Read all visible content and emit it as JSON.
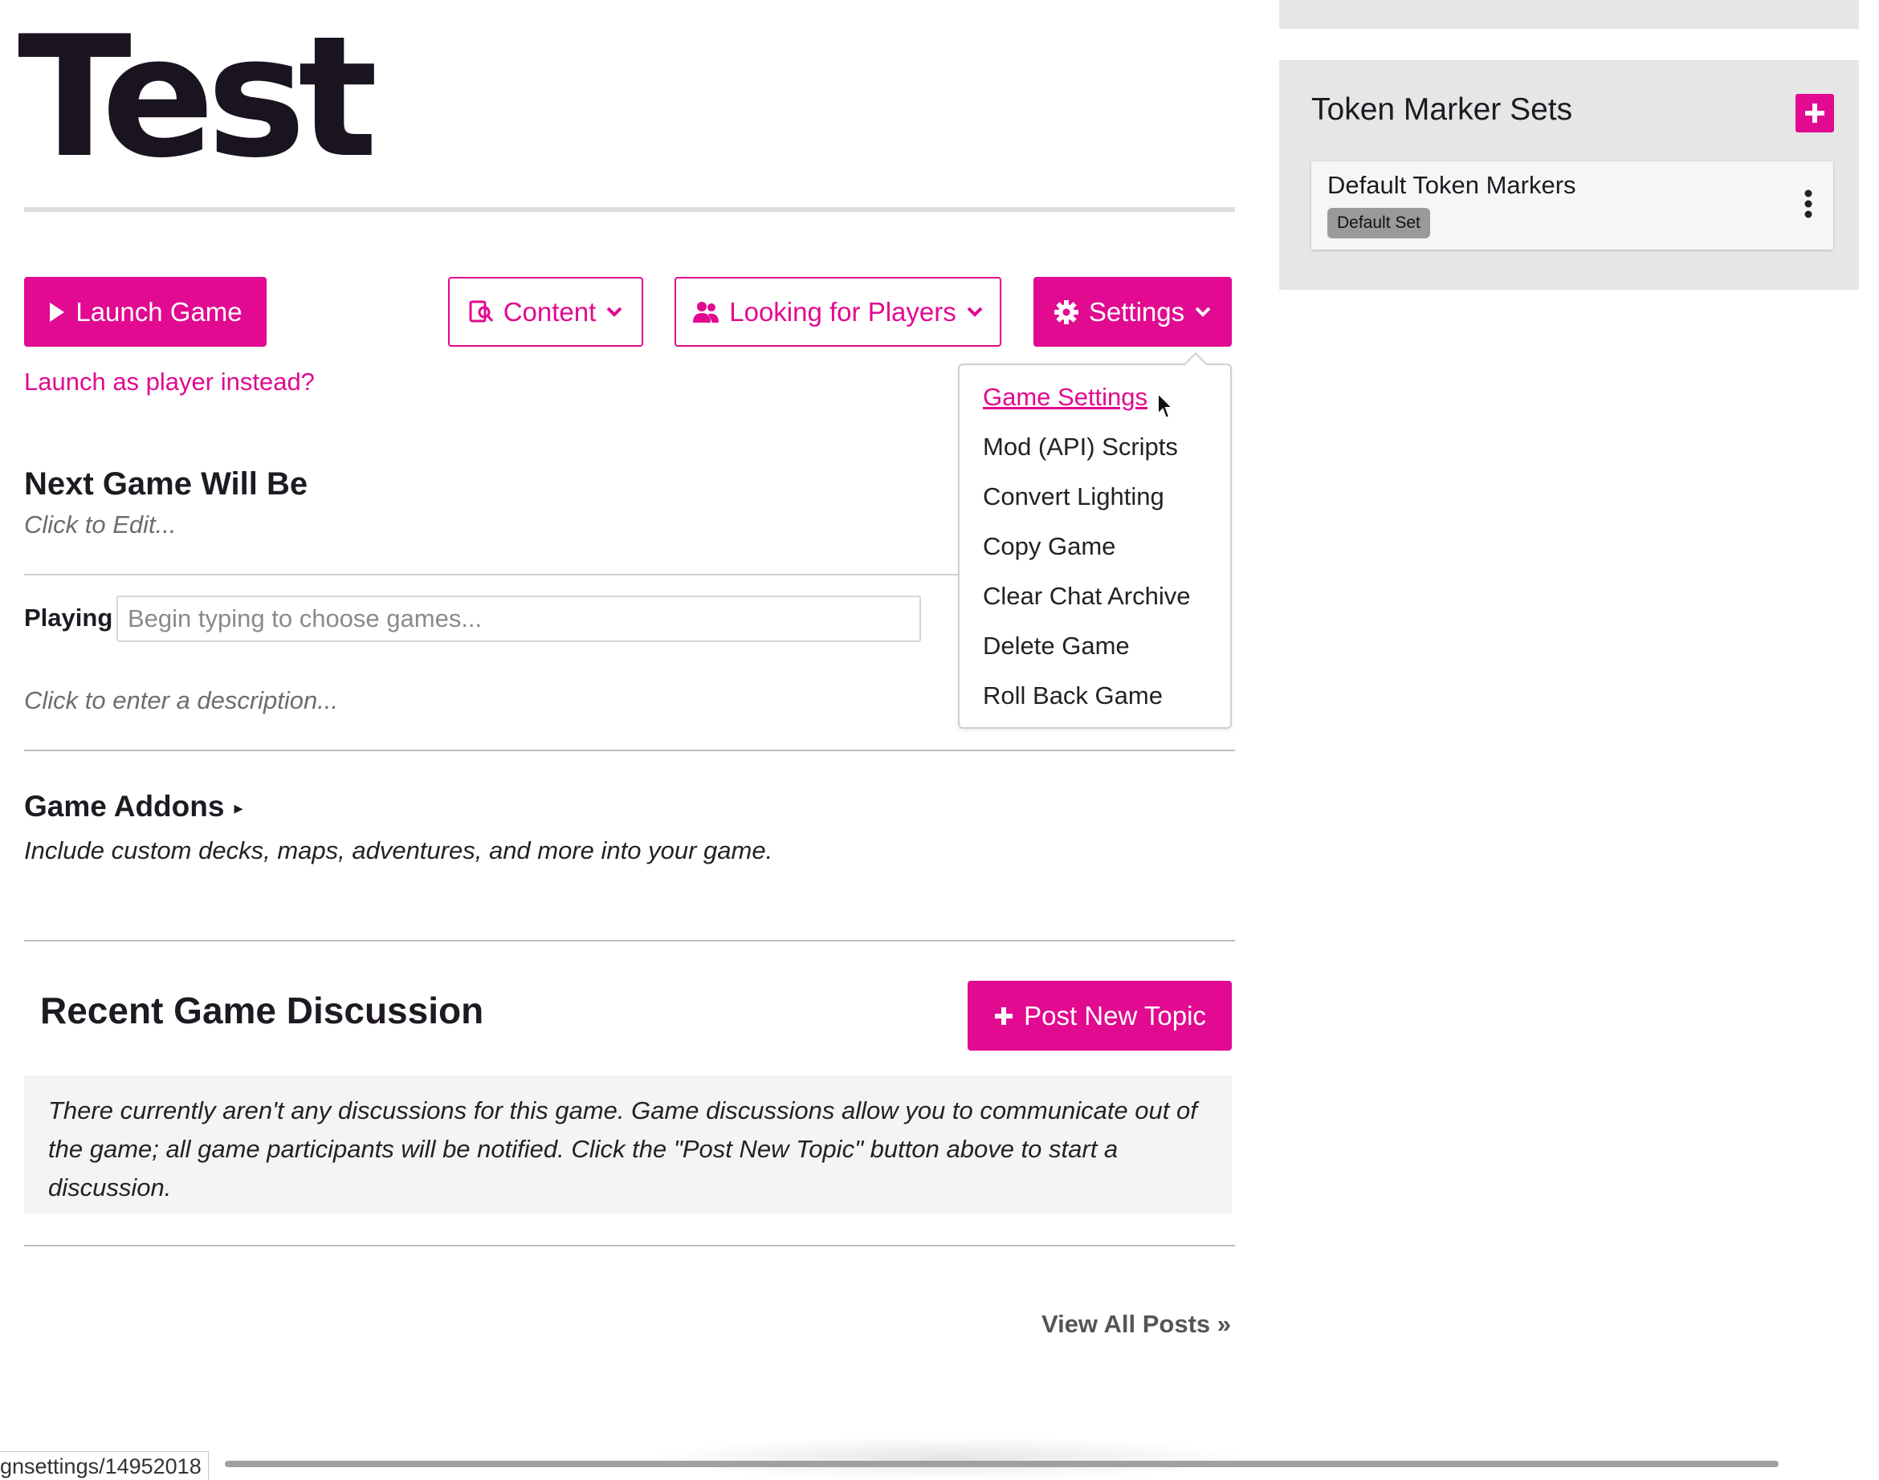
{
  "colors": {
    "accent": "#e10a90",
    "text": "#1f1a22",
    "muted": "#6d6d6d"
  },
  "game": {
    "title": "Test"
  },
  "buttons": {
    "launch": "Launch Game",
    "content": "Content",
    "looking_for_players": "Looking for Players",
    "settings": "Settings",
    "post_new_topic": "Post New Topic"
  },
  "launch_player_link": "Launch as player instead?",
  "settings_menu": {
    "items": [
      {
        "label": "Game Settings",
        "active": true
      },
      {
        "label": "Mod (API) Scripts"
      },
      {
        "label": "Convert Lighting"
      },
      {
        "label": "Copy Game"
      },
      {
        "label": "Clear Chat Archive"
      },
      {
        "label": "Delete Game"
      },
      {
        "label": "Roll Back Game"
      }
    ]
  },
  "next_game": {
    "heading": "Next Game Will Be",
    "placeholder": "Click to Edit..."
  },
  "playing": {
    "label": "Playing",
    "placeholder": "Begin typing to choose games..."
  },
  "description_placeholder": "Click to enter a description...",
  "addons": {
    "heading": "Game Addons",
    "toggle_glyph": "▸",
    "subtitle": "Include custom decks, maps, adventures, and more into your game."
  },
  "discussion": {
    "heading": "Recent Game Discussion",
    "empty_message": "There currently aren't any discussions for this game. Game discussions allow you to communicate out of the game; all game participants will be notified. Click the \"Post New Topic\" button above to start a discussion.",
    "view_all": "View All Posts »"
  },
  "sidebar": {
    "token_markers": {
      "title": "Token Marker Sets",
      "sets": [
        {
          "name": "Default Token Markers",
          "badge": "Default Set"
        }
      ]
    }
  },
  "status_bar": {
    "url": "gnsettings/14952018"
  },
  "icons": [
    "play-icon",
    "content-icon",
    "users-icon",
    "gear-icon",
    "chevron-down-icon",
    "plus-icon",
    "kebab-icon",
    "cursor-icon"
  ]
}
